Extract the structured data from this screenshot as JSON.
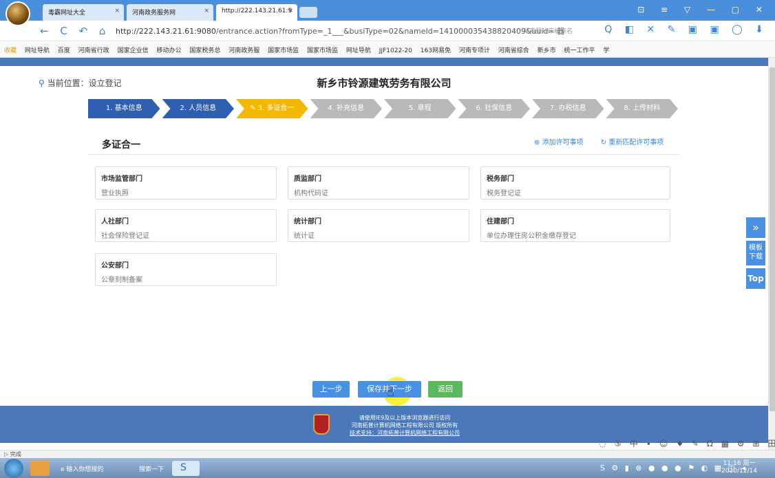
{
  "browser": {
    "tabs": [
      {
        "label": "毒霸网址大全",
        "active": false
      },
      {
        "label": "河南政务服务网",
        "active": false
      },
      {
        "label": "http://222.143.21.61:9",
        "active": true
      }
    ],
    "nav_icons": "← C ↶ ⌂",
    "url_host": "http://222.143.21.61:9080",
    "url_path": "/entrance.action?fromType=_1___&busiType=02&nameId=14100003543882040​9&uuid= 器",
    "search_placeholder": "河南婴儿床被点名",
    "bookmarks": [
      "收藏",
      "网址导航",
      "百度",
      "河南省行政",
      "国家企业信",
      "移动办公",
      "国家税务总",
      "河南政务服",
      "国家市场监",
      "国家市场监",
      "网址导航",
      "JJF1022-20",
      "163网易免",
      "河南专项计",
      "河南省综合",
      "新乡市",
      "统一工作平",
      "学"
    ],
    "window_controls": "⊡ ≡ ▽ — ▢ ✕"
  },
  "page": {
    "location_label": "当前位置：设立登记",
    "company_name": "新乡市铃源建筑劳务有限公司",
    "steps": [
      {
        "label": "1. 基本信息",
        "state": "done"
      },
      {
        "label": "2. 人员信息",
        "state": "done"
      },
      {
        "label": "3. 多证合一",
        "state": "active"
      },
      {
        "label": "4. 补充信息",
        "state": "pending"
      },
      {
        "label": "5. 章程",
        "state": "pending"
      },
      {
        "label": "6. 社保信息",
        "state": "pending"
      },
      {
        "label": "7. 办税信息",
        "state": "pending"
      },
      {
        "label": "8. 上传材料",
        "state": "pending"
      }
    ],
    "section_title": "多证合一",
    "add_permit": "⊕ 添加许可事项",
    "rematch_permit": "↻ 重新匹配许可事项",
    "cards": [
      {
        "dept": "市场监管部门",
        "cert": "营业执照"
      },
      {
        "dept": "质监部门",
        "cert": "机构代码证"
      },
      {
        "dept": "税务部门",
        "cert": "税务登记证"
      },
      {
        "dept": "人社部门",
        "cert": "社会保险登记证"
      },
      {
        "dept": "统计部门",
        "cert": "统计证"
      },
      {
        "dept": "住建部门",
        "cert": "单位办理住房公积金缴存登记"
      },
      {
        "dept": "公安部门",
        "cert": "公章刻制备案"
      }
    ],
    "buttons": {
      "prev": "上一步",
      "save_next": "保存并下一步",
      "back": "返回"
    },
    "side": {
      "expand": "»",
      "template": "模板下载",
      "top": "Top"
    }
  },
  "footer": {
    "line1": "请使用IE9及以上版本浏览器进行访问",
    "line2": "河南拓普计算机网络工程有限公司 版权所有",
    "line3": "技术支持：河南拓普计算机网络工程有限公司"
  },
  "status": {
    "text": "完成"
  },
  "taskbar": {
    "item1": "输入你想搜的",
    "item2": "搜索一下",
    "time": "11:16 周一",
    "date": "2020/12/14"
  },
  "colors": {
    "done": "#2e5fb0",
    "active": "#f5b800",
    "pending": "#b9b9b9",
    "btn_blue": "#4a90e2",
    "btn_green": "#5cb85c"
  }
}
